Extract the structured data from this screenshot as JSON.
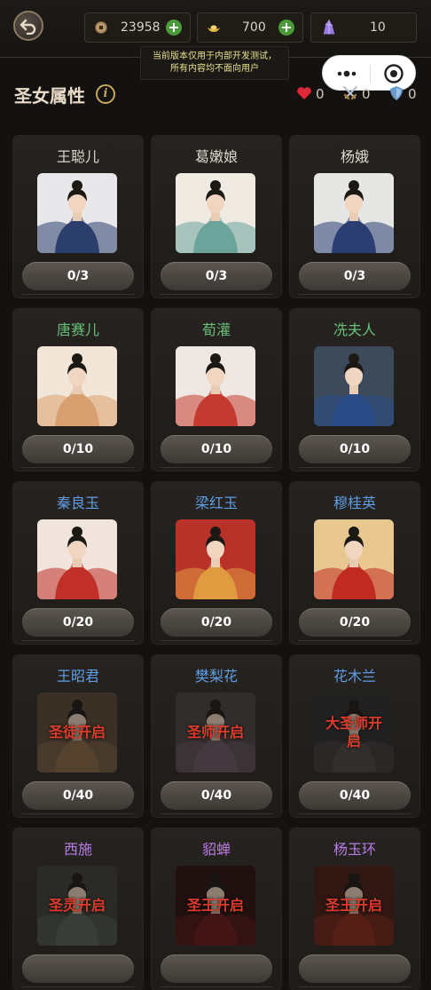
{
  "resources": {
    "coins": "23958",
    "ingots": "700",
    "crystals": "10"
  },
  "notice": [
    "当前版本仅用于内部开发测试，",
    "所有内容均不面向用户"
  ],
  "header": {
    "title": "圣女属性",
    "info_label": "i",
    "stats": [
      {
        "icon": "heart-icon",
        "value": "0"
      },
      {
        "icon": "crossed-swords-icon",
        "value": "0"
      },
      {
        "icon": "shield-icon",
        "value": "0"
      }
    ]
  },
  "colors": {
    "tier_common": "#dcd6cc",
    "tier_green": "#68c07a",
    "tier_blue": "#5f9ee6",
    "tier_purple": "#b87ce8",
    "lock_text": "#e03c2c"
  },
  "heroes": [
    {
      "name": "王聪儿",
      "progress": "0/3",
      "tier": "common",
      "locked": false,
      "lock_label": "",
      "palette": [
        "#e8e8ea",
        "#2c3e6c"
      ]
    },
    {
      "name": "葛嫩娘",
      "progress": "0/3",
      "tier": "common",
      "locked": false,
      "lock_label": "",
      "palette": [
        "#f0ebe2",
        "#6aa49a"
      ]
    },
    {
      "name": "杨娥",
      "progress": "0/3",
      "tier": "common",
      "locked": false,
      "lock_label": "",
      "palette": [
        "#e6e6e4",
        "#2a3e74"
      ]
    },
    {
      "name": "唐赛儿",
      "progress": "0/10",
      "tier": "green",
      "locked": false,
      "lock_label": "",
      "palette": [
        "#f2e6d8",
        "#d8a070"
      ]
    },
    {
      "name": "荀灌",
      "progress": "0/10",
      "tier": "green",
      "locked": false,
      "lock_label": "",
      "palette": [
        "#efe8e2",
        "#c43a30"
      ]
    },
    {
      "name": "冼夫人",
      "progress": "0/10",
      "tier": "green",
      "locked": false,
      "lock_label": "",
      "palette": [
        "#3c4a5a",
        "#2a4c86"
      ]
    },
    {
      "name": "秦良玉",
      "progress": "0/20",
      "tier": "blue",
      "locked": false,
      "lock_label": "",
      "palette": [
        "#f0e4dc",
        "#c03028"
      ]
    },
    {
      "name": "梁红玉",
      "progress": "0/20",
      "tier": "blue",
      "locked": false,
      "lock_label": "",
      "palette": [
        "#b8322a",
        "#e09a40"
      ]
    },
    {
      "name": "穆桂英",
      "progress": "0/20",
      "tier": "blue",
      "locked": false,
      "lock_label": "",
      "palette": [
        "#e8c890",
        "#c02a20"
      ]
    },
    {
      "name": "王昭君",
      "progress": "0/40",
      "tier": "blue",
      "locked": true,
      "lock_label": "圣徒开启",
      "palette": [
        "#5a4a38",
        "#8a6a48"
      ]
    },
    {
      "name": "樊梨花",
      "progress": "0/40",
      "tier": "blue",
      "locked": true,
      "lock_label": "圣师开启",
      "palette": [
        "#4a4444",
        "#6a5a66"
      ]
    },
    {
      "name": "花木兰",
      "progress": "0/40",
      "tier": "blue",
      "locked": true,
      "lock_label": "大圣师开启",
      "palette": [
        "#2e2e30",
        "#4a4644"
      ]
    },
    {
      "name": "西施",
      "progress": "",
      "tier": "purple",
      "locked": true,
      "lock_label": "圣灵开启",
      "palette": [
        "#3c3e3a",
        "#5a6258"
      ]
    },
    {
      "name": "貂蝉",
      "progress": "",
      "tier": "purple",
      "locked": true,
      "lock_label": "圣王开启",
      "palette": [
        "#2a1010",
        "#6a1a1a"
      ]
    },
    {
      "name": "杨玉环",
      "progress": "",
      "tier": "purple",
      "locked": true,
      "lock_label": "圣王开启",
      "palette": [
        "#4a1c14",
        "#8a2a1a"
      ]
    }
  ]
}
